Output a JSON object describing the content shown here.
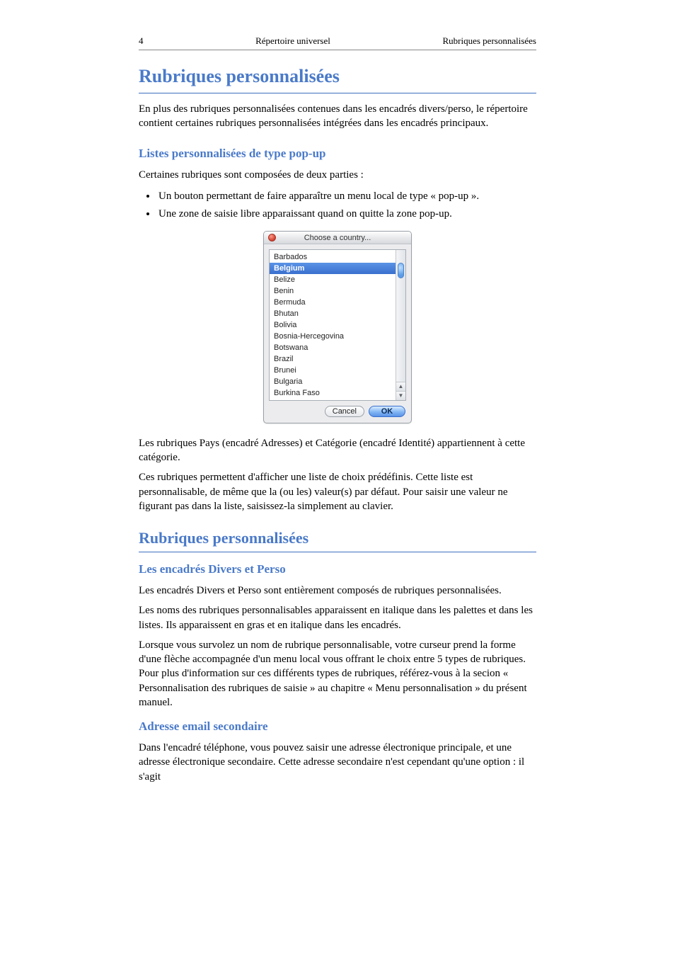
{
  "runningHeader": {
    "pageNum": "4",
    "title": "Répertoire universel",
    "section": "Rubriques personnalisées"
  },
  "chapter": {
    "title": "Rubriques personnalisées",
    "lede": "En plus des rubriques personnalisées contenues dans les encadrés divers/perso, le répertoire contient certaines rubriques personnalisées intégrées dans les encadrés principaux."
  },
  "sec1": {
    "title": "Listes personnalisées de type pop-up",
    "body1": "Certaines rubriques sont composées de deux parties :",
    "bullets": [
      "Un bouton permettant de faire apparaître un menu local de type « pop-up ».",
      "Une zone de saisie libre apparaissant quand on quitte la zone pop-up."
    ],
    "afterFig": "Les rubriques Pays (encadré Adresses) et Catégorie (encadré Identité) appartiennent à cette catégorie.",
    "note": "Ces rubriques permettent d'afficher une liste de choix prédéfinis. Cette liste est personnalisable, de même que la (ou les) valeur(s) par défaut. Pour saisir une valeur ne figurant pas dans la liste, saisissez-la simplement au clavier."
  },
  "sec2": {
    "title": "Rubriques personnalisées",
    "sub1": "Les encadrés Divers et Perso",
    "p1": "Les encadrés Divers et Perso sont entièrement composés de rubriques personnalisées.",
    "p2": "Les noms des rubriques personnalisables apparaissent en italique dans les palettes et dans les listes. Ils apparaissent en gras et en italique dans les encadrés.",
    "p3": "Lorsque vous survolez un nom de rubrique personnalisable, votre curseur prend la forme d'une flèche accompagnée d'un menu local vous offrant le choix entre 5 types de rubriques. Pour plus d'information sur ces différents types de rubriques, référez-vous à la secion « Personnalisation des rubriques de saisie » au chapitre « Menu personnalisation » du présent manuel.",
    "sub2": "Adresse email secondaire",
    "p4": "Dans l'encadré téléphone, vous pouvez saisir une adresse électronique principale, et une adresse électronique secondaire. Cette adresse secondaire n'est cependant qu'une option : il s'agit"
  },
  "dialog": {
    "title": "Choose a country...",
    "items": [
      "Barbados",
      "Belgium",
      "Belize",
      "Benin",
      "Bermuda",
      "Bhutan",
      "Bolivia",
      "Bosnia-Hercegovina",
      "Botswana",
      "Brazil",
      "Brunei",
      "Bulgaria",
      "Burkina Faso"
    ],
    "selectedIndex": 1,
    "buttons": {
      "cancel": "Cancel",
      "ok": "OK"
    }
  }
}
